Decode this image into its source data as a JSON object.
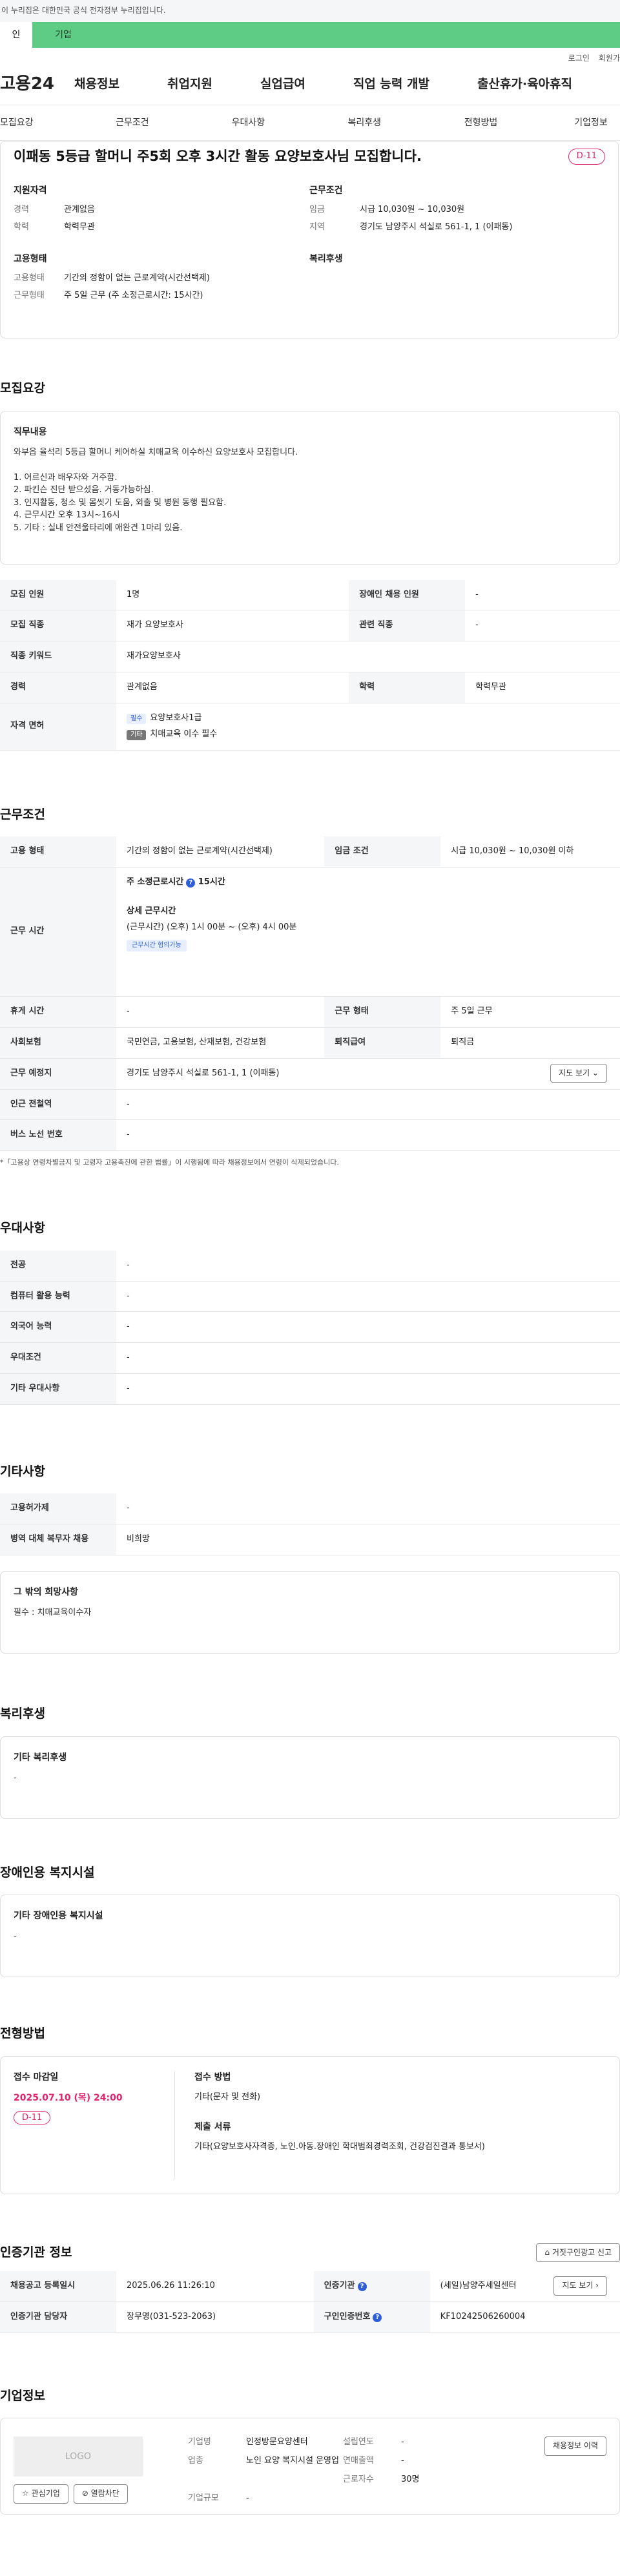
{
  "gov_text": "이 누리집은 대한민국 공식 전자정부 누리집입니다.",
  "tabs": [
    "인",
    "기업"
  ],
  "top_links": [
    "로그인",
    "회원가"
  ],
  "logo": "고용24",
  "gnb": [
    "채용정보",
    "취업지원",
    "실업급여",
    "직업 능력 개발",
    "출산휴가·육아휴직"
  ],
  "subnav": [
    "모집요강",
    "근무조건",
    "우대사항",
    "복리후생",
    "전형방법",
    "기업정보"
  ],
  "summary": {
    "title": "이패동 5등급 할머니 주5회 오후 3시간 활동 요양보호사님 모집합니다.",
    "dday": "D-11",
    "left_h": "지원자격",
    "right_h": "근무조건",
    "career_k": "경력",
    "career_v": "관계없음",
    "edu_k": "학력",
    "edu_v": "학력무관",
    "wage_k": "임금",
    "wage_v": "시급 10,030원 ~ 10,030원",
    "area_k": "지역",
    "area_v": "경기도 남양주시 석실로 561-1, 1 (이패동)",
    "emp_h": "고용형태",
    "welfare_h": "복리후생",
    "emptype_k": "고용형태",
    "emptype_v": "기간의 정함이 없는 근로계약(시간선택제)",
    "worktype_k": "근무형태",
    "worktype_v": "주 5일 근무 (주 소정근로시간: 15시간)"
  },
  "recruit": {
    "title": "모집요강",
    "duty_h": "직무내용",
    "duty": "와부읍 율석리 5등급 할머니 케어하실 치매교육 이수하신 요양보호사 모집합니다.\n\n1. 어르신과 배우자와 거주함.\n2. 파킨슨 진단 받으셨음. 거동가능하심.\n3. 인지활동, 청소 및 몸씻기 도움, 외출 및 병원 동행 필요함.\n4. 근무시간 오후 13시~16시\n5. 기타 : 실내 안전울타리에 애완견 1마리 있음.",
    "count_k": "모집 인원",
    "count_v": "1명",
    "dis_k": "장애인 채용 인원",
    "dis_v": "-",
    "job_k": "모집 직종",
    "job_v": "재가 요양보호사",
    "rel_k": "관련 직종",
    "rel_v": "-",
    "kw_k": "직종 키워드",
    "kw_v": "재가요양보호사",
    "car_k": "경력",
    "car_v": "관계없음",
    "edu_k": "학력",
    "edu_v": "학력무관",
    "lic_k": "자격 면허",
    "lic1_badge": "필수",
    "lic1": "요양보호사1급",
    "lic2_badge": "기타",
    "lic2": "치매교육 이수 필수"
  },
  "work": {
    "title": "근무조건",
    "emp_k": "고용 형태",
    "emp_v": "기간의 정함이 없는 근로계약(시간선택제)",
    "wage_k": "임금 조건",
    "wage_v": "시급 10,030원 ~ 10,030원 이하",
    "time_k": "근무 시간",
    "weekly": "주 소정근로시간",
    "weekly_v": "15시간",
    "detail_h": "상세 근무시간",
    "detail_1": "(근무시간) (오후) 1시 00분 ~ (오후) 4시 00분",
    "flex": "근무시간 협의가능",
    "rest_k": "휴게 시간",
    "rest_v": "-",
    "form_k": "근무 형태",
    "form_v": "주 5일 근무",
    "ins_k": "사회보험",
    "ins_v": "국민연금, 고용보험, 산재보험, 건강보험",
    "ret_k": "퇴직급여",
    "ret_v": "퇴직금",
    "place_k": "근무 예정지",
    "place_v": "경기도 남양주시 석실로 561-1, 1 (이패동)",
    "map_btn": "지도 보기 ⌄",
    "sub_k": "인근 전철역",
    "sub_v": "-",
    "bus_k": "버스 노선 번호",
    "bus_v": "-",
    "note": "*「고용상 연령차별금지 및 고령자 고용촉진에 관한 법률」이 시행됨에 따라 채용정보에서 연령이 삭제되었습니다."
  },
  "pref": {
    "title": "우대사항",
    "rows": [
      [
        "전공",
        "-"
      ],
      [
        "컴퓨터 활용 능력",
        "-"
      ],
      [
        "외국어 능력",
        "-"
      ],
      [
        "우대조건",
        "-"
      ],
      [
        "기타 우대사항",
        "-"
      ]
    ]
  },
  "etc": {
    "title": "기타사항",
    "r1k": "고용허가제",
    "r1v": "-",
    "r2k": "병역 대체 복무자 채용",
    "r2v": "비희망",
    "box_h": "그 밖의 희망사항",
    "box_v": "필수 : 치매교육이수자"
  },
  "welfare": {
    "title": "복리후생",
    "box_h": "기타 복리후생",
    "box_v": "-"
  },
  "disfac": {
    "title": "장애인용 복지시설",
    "box_h": "기타 장애인용 복지시설",
    "box_v": "-"
  },
  "select": {
    "title": "전형방법",
    "deadline_h": "접수 마감일",
    "deadline": "2025.07.10 (목) 24:00",
    "dday": "D-11",
    "method_h": "접수 방법",
    "method": "기타(문자 및 전화)",
    "docs_h": "제출 서류",
    "docs": "기타(요양보호사자격증, 노인.아동.장애인 학대범죄경력조회, 건강검진결과 통보서)"
  },
  "cert": {
    "title": "인증기관 정보",
    "report_btn": "거짓구인광고 신고",
    "r1k": "채용공고 등록일시",
    "r1v": "2025.06.26 11:26:10",
    "r1k2": "인증기관",
    "r1v2": "(세일)남양주세일센터",
    "map_btn": "지도 보기 ›",
    "r2k": "인증기관 담당자",
    "r2v": "장무영(031-523-2063)",
    "r2k2": "구인인증번호",
    "r2v2": "KF10242506260004"
  },
  "company": {
    "title": "기업정보",
    "logo": "LOGO",
    "fav_btn": "☆ 관심기업",
    "block_btn": "⊘ 열람차단",
    "name_k": "기업명",
    "name_v": "인정방문요양센터",
    "year_k": "설립연도",
    "year_v": "-",
    "biz_k": "업종",
    "biz_v": "노인 요양 복지시설 운영업",
    "sales_k": "연매출액",
    "sales_v": "-",
    "emp_k": "근로자수",
    "emp_v": "30명",
    "size_k": "기업규모",
    "size_v": "-",
    "jobs_btn": "채용정보 이력"
  }
}
